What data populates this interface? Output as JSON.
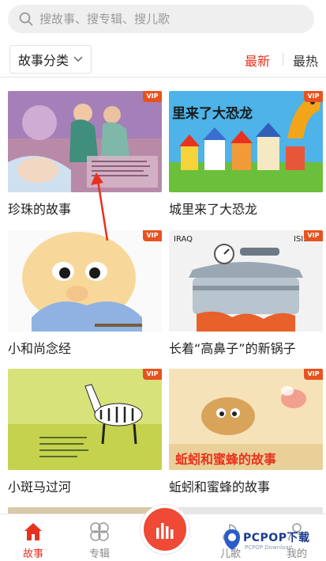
{
  "search": {
    "placeholder": "搜故事、搜专辑、搜儿歌",
    "icon": "search-icon"
  },
  "filter": {
    "category_label": "故事分类",
    "sort_newest": "最新",
    "sort_hottest": "最热",
    "active_sort": "最新"
  },
  "stories": [
    {
      "title": "珍珠的故事",
      "badge": "VIP"
    },
    {
      "title": "城里来了大恐龙",
      "badge": "VIP",
      "cover_text": "里来了大恐龙"
    },
    {
      "title": "小和尚念经",
      "badge": "VIP"
    },
    {
      "title": "长着“高鼻子”的新锅子",
      "badge": "VIP",
      "cover_text_left": "IRAQ",
      "cover_text_right": "ISIS"
    },
    {
      "title": "小斑马过河",
      "badge": "VIP"
    },
    {
      "title": "蚯蚓和蜜蜂的故事",
      "badge": "VIP",
      "cover_text": "蚯蚓和蜜蜂的故事"
    }
  ],
  "bottom_nav": {
    "tabs": [
      {
        "label": "故事",
        "icon": "house-icon",
        "active": true
      },
      {
        "label": "专辑",
        "icon": "flower-icon",
        "active": false
      },
      {
        "label": "儿歌",
        "icon": "music-icon",
        "active": false
      },
      {
        "label": "我的",
        "icon": "person-icon",
        "active": false
      }
    ],
    "play_icon": "equalizer-icon"
  },
  "watermark": {
    "text": "PCPOP下载",
    "sub": "PCPOP Download"
  },
  "colors": {
    "accent": "#e8321e",
    "vip": "#e8521e",
    "play": "#ee4a36"
  }
}
